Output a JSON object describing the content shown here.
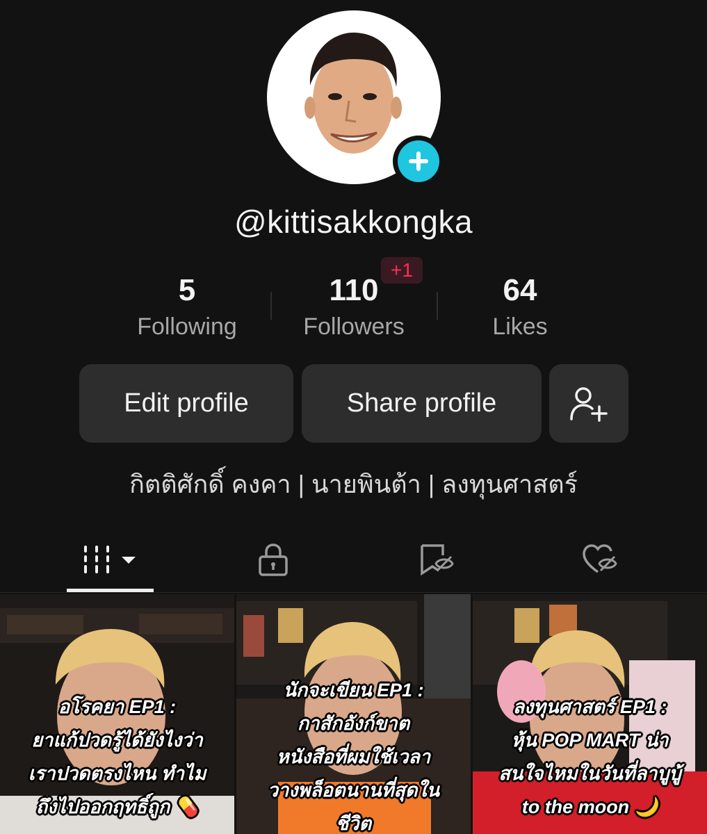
{
  "profile": {
    "username": "@kittisakkongka",
    "bio": "กิตติศักดิ์ คงคา | นายพินต้า | ลงทุนศาสตร์"
  },
  "stats": {
    "following": {
      "value": "5",
      "label": "Following"
    },
    "followers": {
      "value": "110",
      "label": "Followers",
      "new_badge": "+1"
    },
    "likes": {
      "value": "64",
      "label": "Likes"
    }
  },
  "actions": {
    "edit_label": "Edit profile",
    "share_label": "Share profile"
  },
  "tabs": [
    {
      "icon": "grid-icon",
      "active": true
    },
    {
      "icon": "lock-icon",
      "active": false
    },
    {
      "icon": "saved-hidden-icon",
      "active": false
    },
    {
      "icon": "liked-hidden-icon",
      "active": false
    }
  ],
  "videos": [
    {
      "caption_lines": [
        "อโรคยา EP1 :",
        "ยาแก้ปวดรู้ได้ยังไงว่า",
        "เราปวดตรงไหน ทำไม",
        "ถึงไปออกฤทธิ์ถูก 💊"
      ]
    },
    {
      "caption_lines": [
        "นักจะเขียน EP1 :",
        "กาสักอังก์ขาต",
        "หนังสือที่ผมใช้เวลา",
        "วางพล็อตนานที่สุดใน",
        "ชีวิต"
      ]
    },
    {
      "caption_lines": [
        "ลงทุนศาสตร์ EP1 :",
        "หุ้น POP MART น่า",
        "สนใจไหมในวันที่ลาบูบู้",
        "to the moon 🌙"
      ]
    }
  ],
  "colors": {
    "background": "#121212",
    "button": "#2d2d2d",
    "accent_badge": "#20c5e0",
    "notification": "#fe2c55"
  }
}
